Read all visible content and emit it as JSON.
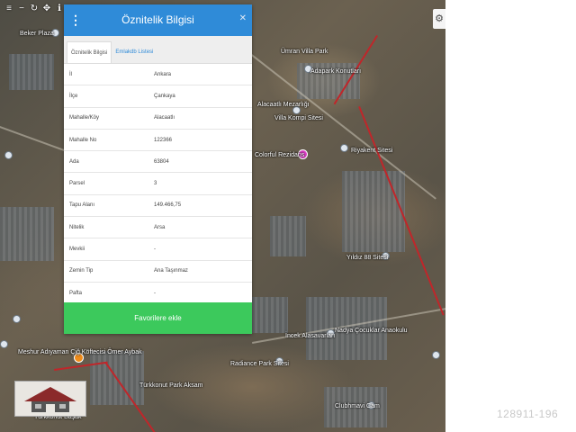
{
  "map": {
    "toolbar": [
      {
        "icon": "menu-icon",
        "glyph": "≡"
      },
      {
        "icon": "zoom-out-icon",
        "glyph": "−"
      },
      {
        "icon": "refresh-icon",
        "glyph": "↻"
      },
      {
        "icon": "move-icon",
        "glyph": "✥"
      },
      {
        "icon": "info-icon",
        "glyph": "ℹ"
      }
    ],
    "settings_glyph": "⚙",
    "labels": [
      "Beker Plaza",
      "Ümran Villa Park",
      "Adapark Konutları",
      "Alacaatlı Mezarlığı",
      "Villa Kompi Sitesi",
      "Colorful Rezidans",
      "Riyakent Sitesi",
      "Yıldız 88 Sitesi",
      "Meshur Adıyaman Çiğ Köftecisi Ömer Aybak",
      "Radiance Park Sitesi",
      "İncek Alasavarları",
      "Nadya Çocuklar Anaokulu",
      "Türkkonut Park Aksam",
      "Clubhmavi Cam",
      "Türkkonut Başak"
    ]
  },
  "panel": {
    "menu_glyph": "⋮",
    "title": "Öznitelik Bilgisi",
    "close_glyph": "✕",
    "tabs": [
      "Öznitelik Bilgisi",
      "Emlakdb Listesi"
    ],
    "rows": [
      {
        "key": "İl",
        "value": "Ankara"
      },
      {
        "key": "İlçe",
        "value": "Çankaya"
      },
      {
        "key": "Mahalle/Köy",
        "value": "Alacaatlı"
      },
      {
        "key": "Mahalle No",
        "value": "122366"
      },
      {
        "key": "Ada",
        "value": "63804"
      },
      {
        "key": "Parsel",
        "value": "3"
      },
      {
        "key": "Tapu Alanı",
        "value": "149.466,75"
      },
      {
        "key": "Nitelik",
        "value": "Arsa"
      },
      {
        "key": "Mevkii",
        "value": "-"
      },
      {
        "key": "Zemin Tip",
        "value": "Ana Taşınmaz"
      },
      {
        "key": "Pafta",
        "value": "-"
      }
    ],
    "favorite_button": "Favorilere ekle"
  },
  "watermark": "128911-196",
  "colors": {
    "header": "#2f8bd8",
    "favorite": "#3cc95c",
    "road": "#c0262a"
  }
}
